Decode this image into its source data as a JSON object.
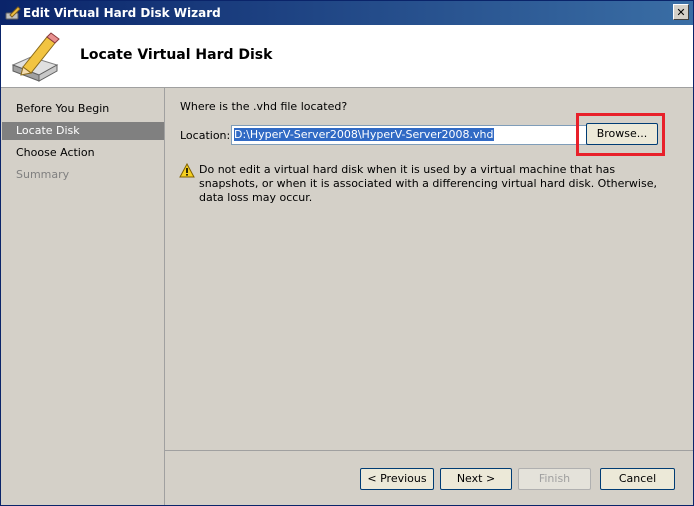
{
  "window": {
    "title": "Edit Virtual Hard Disk Wizard",
    "close_glyph": "✕"
  },
  "header": {
    "title": "Locate Virtual Hard Disk",
    "icon": "pencil-disk-icon"
  },
  "sidebar": {
    "items": [
      {
        "label": "Before You Begin",
        "state": "normal"
      },
      {
        "label": "Locate Disk",
        "state": "active"
      },
      {
        "label": "Choose Action",
        "state": "normal"
      },
      {
        "label": "Summary",
        "state": "disabled"
      }
    ]
  },
  "main": {
    "question": "Where is the .vhd file located?",
    "location_label": "Location:",
    "location_value": "D:\\HyperV-Server2008\\HyperV-Server2008.vhd",
    "browse_label": "Browse...",
    "warning_text": "Do not edit a virtual hard disk when it is used by a virtual machine that has snapshots, or when it is associated with a differencing virtual hard disk. Otherwise, data loss may occur.",
    "highlight_color": "#e8202a"
  },
  "footer": {
    "previous_label": "< Previous",
    "next_label": "Next >",
    "finish_label": "Finish",
    "cancel_label": "Cancel"
  }
}
